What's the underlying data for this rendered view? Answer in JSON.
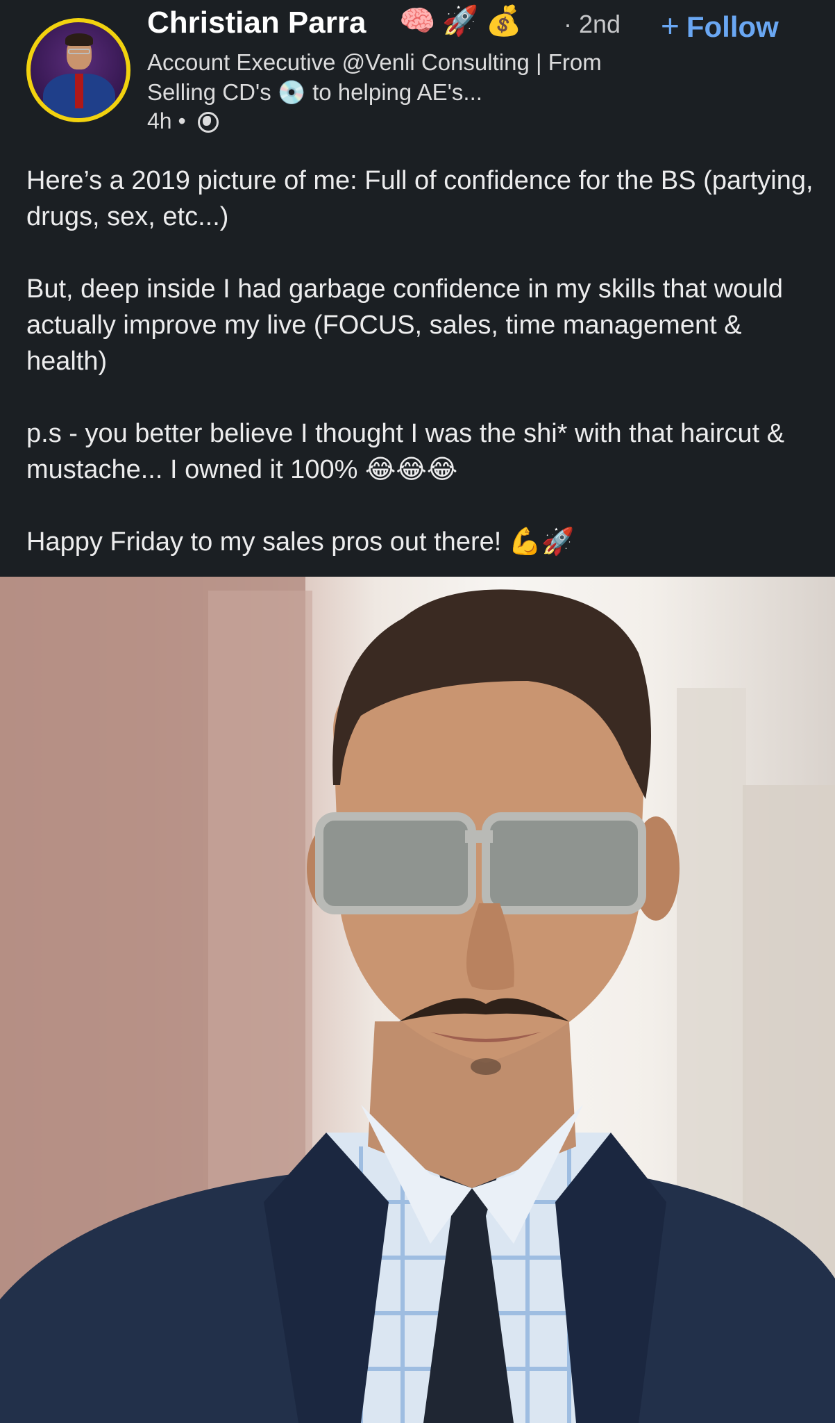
{
  "author": {
    "name": "Christian Parra",
    "badges": "🧠🚀💰",
    "degree": "· 2nd",
    "headline": "Account Executive @Venli Consulting | From Selling CD's 💿 to helping AE's...",
    "time": "4h •",
    "visibility_icon": "globe-icon"
  },
  "actions": {
    "follow_icon": "plus-icon",
    "follow_label": "Follow"
  },
  "post": {
    "paragraphs": [
      "Here’s a 2019 picture of me: Full of confidence for the BS (partying, drugs, sex, etc...)",
      "But, deep inside I had garbage confidence in my skills that would actually improve my live (FOCUS, sales, time management & health)",
      "p.s - you better believe I thought I was the shi* with that haircut & mustache... I owned it 100% 😂😂😂",
      "Happy Friday to my sales pros out there! 💪🚀"
    ]
  },
  "colors": {
    "background": "#1b1f23",
    "accent": "#6aa7f3",
    "avatar_ring": "#f2d20f"
  }
}
